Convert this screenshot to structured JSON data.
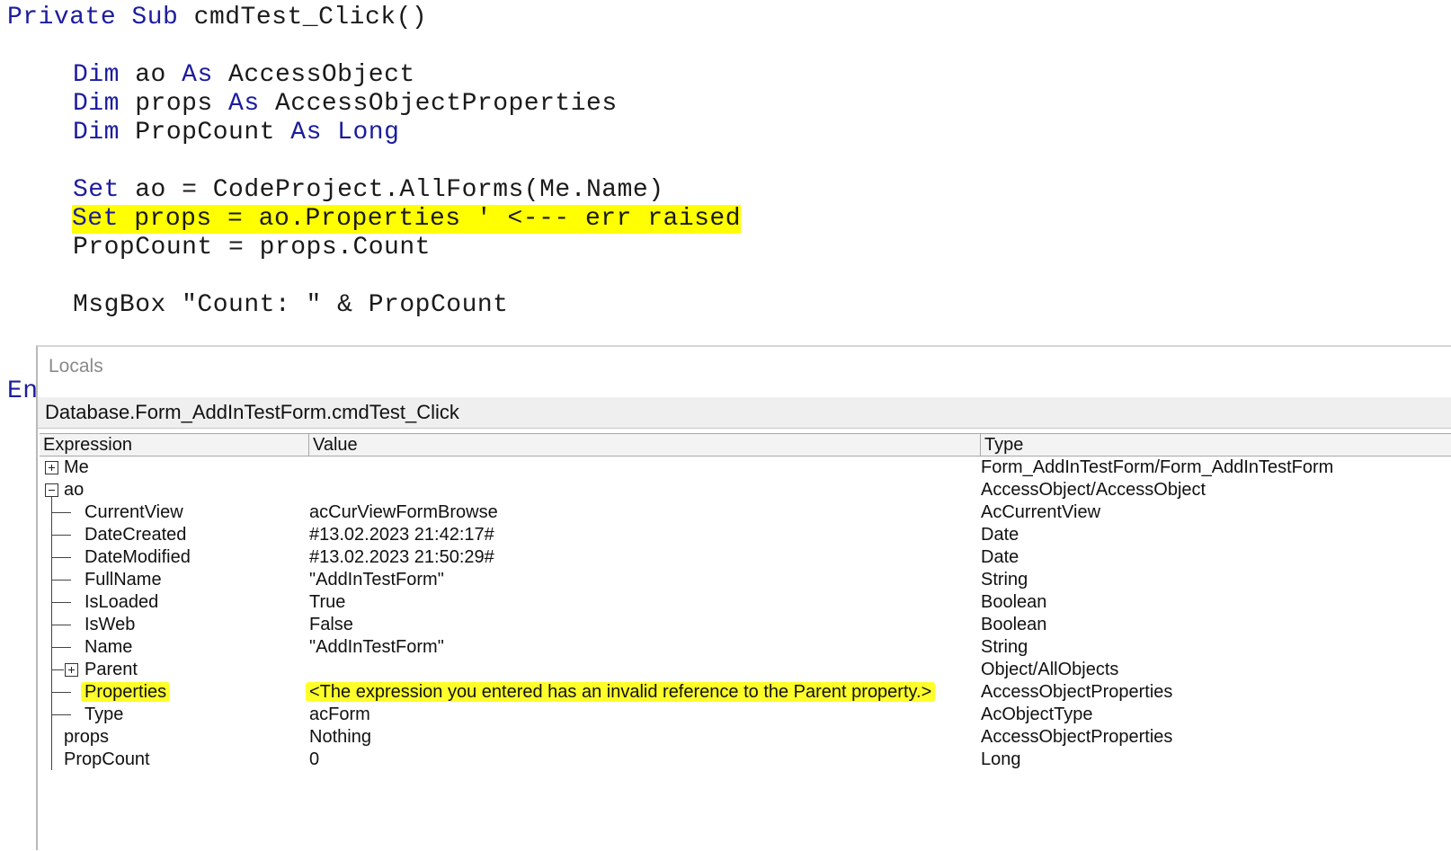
{
  "code": {
    "line1": {
      "kw": "Private Sub",
      "rest": " cmdTest_Click()"
    },
    "dim1": {
      "kw1": "Dim",
      "name": " ao ",
      "kw2": "As",
      "type": " AccessObject"
    },
    "dim2": {
      "kw1": "Dim",
      "name": " props ",
      "kw2": "As",
      "type": " AccessObjectProperties"
    },
    "dim3": {
      "kw1": "Dim",
      "name": " PropCount ",
      "kw2": "As",
      "kw3": " Long"
    },
    "set1": {
      "kw": "Set",
      "rest": " ao = CodeProject.AllForms(Me.Name)"
    },
    "set2": {
      "kw": "Set",
      "rest": " props = ao.Properties ' <--- err raised"
    },
    "count_line": "PropCount = props.Count",
    "msgbox_line": "MsgBox \"Count: \" & PropCount",
    "end_partial": "En"
  },
  "locals": {
    "title": "Locals",
    "context": "Database.Form_AddInTestForm.cmdTest_Click",
    "columns": [
      "Expression",
      "Value",
      "Type"
    ],
    "rows": [
      {
        "expr": "Me",
        "value": "",
        "type": "Form_AddInTestForm/Form_AddInTestForm"
      },
      {
        "expr": "ao",
        "value": "",
        "type": "AccessObject/AccessObject"
      },
      {
        "expr": "CurrentView",
        "value": "acCurViewFormBrowse",
        "type": "AcCurrentView"
      },
      {
        "expr": "DateCreated",
        "value": "#13.02.2023 21:42:17#",
        "type": "Date"
      },
      {
        "expr": "DateModified",
        "value": "#13.02.2023 21:50:29#",
        "type": "Date"
      },
      {
        "expr": "FullName",
        "value": "\"AddInTestForm\"",
        "type": "String"
      },
      {
        "expr": "IsLoaded",
        "value": "True",
        "type": "Boolean"
      },
      {
        "expr": "IsWeb",
        "value": "False",
        "type": "Boolean"
      },
      {
        "expr": "Name",
        "value": "\"AddInTestForm\"",
        "type": "String"
      },
      {
        "expr": "Parent",
        "value": "",
        "type": "Object/AllObjects"
      },
      {
        "expr": "Properties",
        "value": "<The expression you entered has an invalid reference to the Parent property.>",
        "type": "AccessObjectProperties"
      },
      {
        "expr": "Type",
        "value": "acForm",
        "type": "AcObjectType"
      },
      {
        "expr": "props",
        "value": "Nothing",
        "type": "AccessObjectProperties"
      },
      {
        "expr": "PropCount",
        "value": "0",
        "type": "Long"
      }
    ]
  },
  "colors": {
    "keyword": "#1c1c9e",
    "highlight": "#ffff00",
    "text": "#1a1a1a"
  }
}
